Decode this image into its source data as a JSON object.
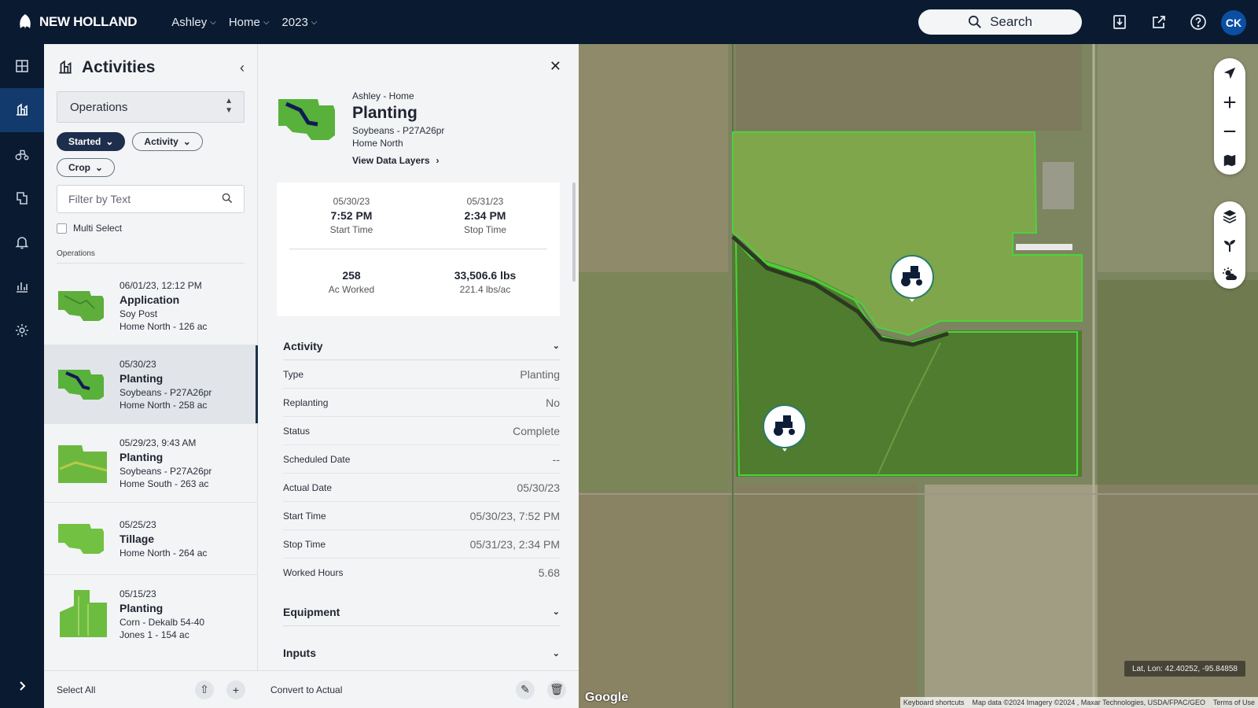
{
  "app": {
    "brand": "NEW HOLLAND",
    "brand_color": "#0a1a31",
    "accent": "#123a6d"
  },
  "header": {
    "crumbs": [
      {
        "label": "Ashley"
      },
      {
        "label": "Home"
      },
      {
        "label": "2023"
      }
    ],
    "search_label": "Search",
    "avatar_initials": "CK",
    "icons": [
      "download-icon",
      "external-link-icon",
      "help-icon"
    ]
  },
  "rail": {
    "items": [
      "dashboard-icon",
      "activities-icon",
      "equipment-icon",
      "fields-icon",
      "alerts-icon",
      "reports-icon",
      "settings-icon"
    ],
    "expand_icon": "chevron-right-icon"
  },
  "activities": {
    "title": "Activities",
    "select_value": "Operations",
    "chips": [
      {
        "label": "Started",
        "active": true
      },
      {
        "label": "Activity"
      },
      {
        "label": "Crop"
      }
    ],
    "filter_placeholder": "Filter by Text",
    "multi_select_label": "Multi Select",
    "list_label": "Operations",
    "items": [
      {
        "date": "06/01/23, 12:12 PM",
        "title": "Application",
        "crop": "Soy Post",
        "location": "Home North - 126 ac"
      },
      {
        "date": "05/30/23",
        "title": "Planting",
        "crop": "Soybeans - P27A26pr",
        "location": "Home North - 258 ac"
      },
      {
        "date": "05/29/23, 9:43 AM",
        "title": "Planting",
        "crop": "Soybeans - P27A26pr",
        "location": "Home South - 263 ac"
      },
      {
        "date": "05/25/23",
        "title": "Tillage",
        "crop": "",
        "location": "Home North - 264 ac"
      },
      {
        "date": "05/15/23",
        "title": "Planting",
        "crop": "Corn - Dekalb 54-40",
        "location": "Jones 1 - 154 ac"
      }
    ],
    "footer": {
      "select_all": "Select All"
    }
  },
  "detail": {
    "breadcrumb": "Ashley - Home",
    "title": "Planting",
    "crop": "Soybeans - P27A26pr",
    "field": "Home North",
    "view_layers": "View Data Layers",
    "stats": {
      "start_date": "05/30/23",
      "start_time": "7:52 PM",
      "start_label": "Start Time",
      "stop_date": "05/31/23",
      "stop_time": "2:34 PM",
      "stop_label": "Stop Time",
      "worked": "258",
      "worked_label": "Ac Worked",
      "total": "33,506.6 lbs",
      "rate": "221.4 lbs/ac"
    },
    "activity_section": "Activity",
    "rows": [
      {
        "key": "Type",
        "value": "Planting"
      },
      {
        "key": "Replanting",
        "value": "No"
      },
      {
        "key": "Status",
        "value": "Complete"
      },
      {
        "key": "Scheduled Date",
        "value": "--"
      },
      {
        "key": "Actual Date",
        "value": "05/30/23"
      },
      {
        "key": "Start Time",
        "value": "05/30/23, 7:52 PM"
      },
      {
        "key": "Stop Time",
        "value": "05/31/23, 2:34 PM"
      },
      {
        "key": "Worked Hours",
        "value": "5.68"
      }
    ],
    "equipment_section": "Equipment",
    "inputs_section": "Inputs",
    "footer": {
      "convert": "Convert to Actual"
    }
  },
  "map": {
    "latlon": "Lat, Lon: 42.40252, -95.84858",
    "attribution": [
      "Keyboard shortcuts",
      "Map data ©2024 Imagery ©2024 , Maxar Technologies, USDA/FPAC/GEO",
      "Terms of Use"
    ],
    "google": "Google",
    "boundary_color": "#4bd33a"
  }
}
